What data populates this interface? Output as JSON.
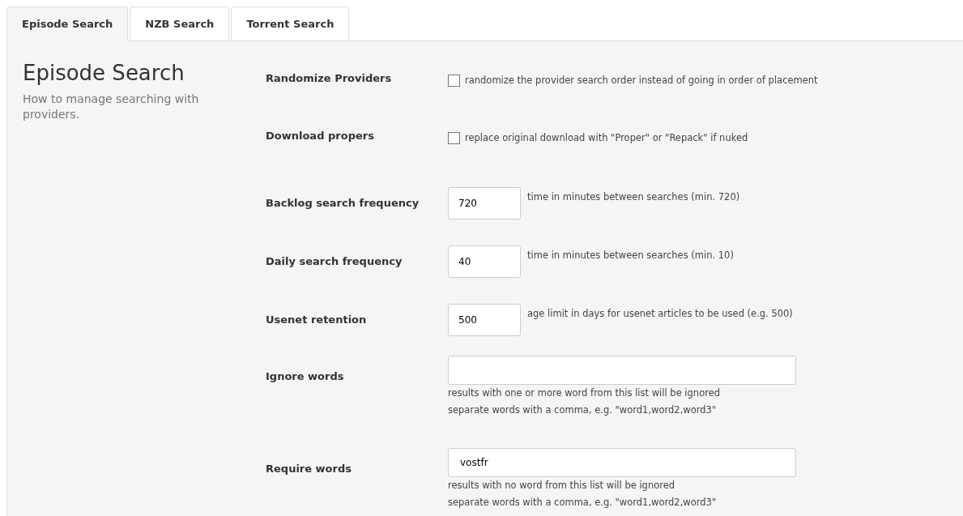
{
  "tabs": [
    {
      "label": "Episode Search",
      "selected": true
    },
    {
      "label": "NZB Search",
      "selected": false
    },
    {
      "label": "Torrent Search",
      "selected": false
    }
  ],
  "section": {
    "title": "Episode Search",
    "description": "How to manage searching with providers."
  },
  "settings": [
    {
      "kind": "checkbox",
      "label": "Randomize Providers",
      "checked": false,
      "help": [
        "randomize the provider search order instead of going in order of placement"
      ]
    },
    {
      "kind": "checkbox",
      "label": "Download propers",
      "checked": false,
      "help": [
        "replace original download with \"Proper\" or \"Repack\" if nuked"
      ]
    },
    {
      "kind": "number",
      "label": "Backlog search frequency",
      "value": "720",
      "help": [
        "time in minutes between searches (min. 720)"
      ]
    },
    {
      "kind": "number",
      "label": "Daily search frequency",
      "value": "40",
      "help": [
        "time in minutes between searches (min. 10)"
      ]
    },
    {
      "kind": "number",
      "label": "Usenet retention",
      "value": "500",
      "help": [
        "age limit in days for usenet articles to be used (e.g. 500)"
      ]
    },
    {
      "kind": "text",
      "label": "Ignore words",
      "help": [
        "results with one or more word from this list will be ignored",
        "separate words with a comma, e.g. \"word1,word2,word3\""
      ]
    },
    {
      "kind": "text",
      "label": "Require words",
      "value": "vostfr",
      "help": [
        "results with no word from this list will be ignored",
        "separate words with a comma, e.g. \"word1,word2,word3\""
      ]
    }
  ]
}
